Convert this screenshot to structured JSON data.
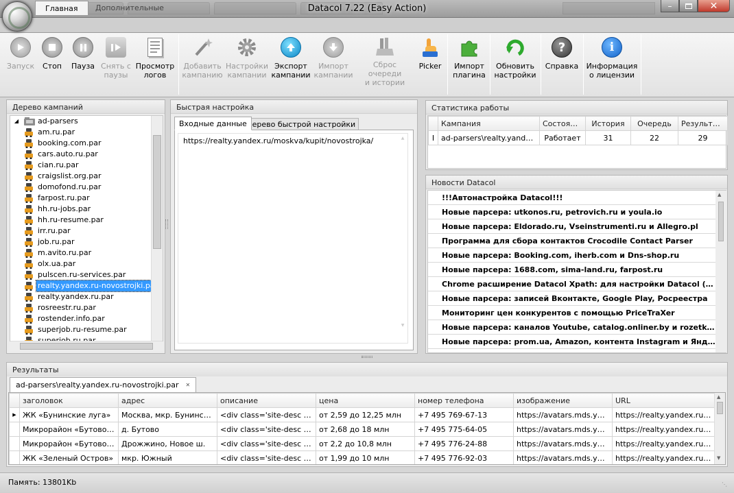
{
  "window": {
    "title": "Datacol 7.22 (Easy Action)"
  },
  "ribbon_tabs": [
    {
      "label": "Главная"
    },
    {
      "label": "Дополнительные"
    }
  ],
  "toolbar": {
    "start": {
      "l1": "Запуск",
      "l2": ""
    },
    "stop": {
      "l1": "Стоп",
      "l2": ""
    },
    "pause": {
      "l1": "Пауза",
      "l2": ""
    },
    "unpause": {
      "l1": "Снять с",
      "l2": "паузы"
    },
    "logs": {
      "l1": "Просмотр",
      "l2": "логов"
    },
    "add_campaign": {
      "l1": "Добавить",
      "l2": "кампанию"
    },
    "campaign_settings": {
      "l1": "Настройки",
      "l2": "кампании"
    },
    "export_campaign": {
      "l1": "Экспорт",
      "l2": "кампании"
    },
    "import_campaign": {
      "l1": "Импорт",
      "l2": "кампании"
    },
    "reset_queue": {
      "l1": "Сброс очереди",
      "l2": "и истории"
    },
    "picker": {
      "l1": "Picker",
      "l2": ""
    },
    "import_plugin": {
      "l1": "Импорт",
      "l2": "плагина"
    },
    "update_settings": {
      "l1": "Обновить",
      "l2": "настройки"
    },
    "help": {
      "l1": "Справка",
      "l2": ""
    },
    "license": {
      "l1": "Информация",
      "l2": "о лицензии"
    }
  },
  "campaign_tree": {
    "title": "Дерево кампаний",
    "root": "ad-parsers",
    "items": [
      "am.ru.par",
      "booking.com.par",
      "cars.auto.ru.par",
      "cian.ru.par",
      "craigslist.org.par",
      "domofond.ru.par",
      "farpost.ru.par",
      "hh.ru-jobs.par",
      "hh.ru-resume.par",
      "irr.ru.par",
      "job.ru.par",
      "m.avito.ru.par",
      "olx.ua.par",
      "pulscen.ru-services.par",
      "realty.yandex.ru-novostrojki.par",
      "realty.yandex.ru.par",
      "rosreestr.ru.par",
      "rostender.info.par",
      "superjob.ru-resume.par",
      "superjob.ru.par"
    ],
    "selected_index": 14
  },
  "quick_setup": {
    "title": "Быстрая настройка",
    "tabs": [
      "Входные данные",
      "Дерево быстрой настройки"
    ],
    "input_text": "https://realty.yandex.ru/moskva/kupit/novostrojka/"
  },
  "stats": {
    "title": "Статистика работы",
    "columns": [
      "Кампания",
      "Состояние",
      "История",
      "Очередь",
      "Результаты"
    ],
    "rows": [
      {
        "campaign": "ad-parsers\\realty.yandex.ru-novostrojki.par",
        "state": "Работает",
        "history": "31",
        "queue": "22",
        "results": "29"
      }
    ]
  },
  "news": {
    "title": "Новости Datacol",
    "items": [
      "!!!Автонастройка Datacol!!!",
      "Новые парсера: utkonos.ru, petrovich.ru и youla.io",
      "Новые парсера: Eldorado.ru, Vseinstrumenti.ru и Allegro.pl",
      "Программа для  сбора контактов Crocodile Contact Parser",
      "Новые парсера: Booking.com, iherb.com и Dns-shop.ru",
      "Новые парсера: 1688.com, sima-land.ru, farpost.ru",
      "Chrome расширение Datacol Xpath: для настройки Datacol (ВИДЕО)",
      "Новые парсера: записей Вконтакте, Google Play, Росреестра",
      "Мониторинг цен конкурентов с помощью PriceTraXer",
      "Новые парсера: каналов Youtube, catalog.onliner.by и rozetka.ua",
      "Новые парсера: prom.ua, Amazon, контента Instagram и Яндекс Маркет"
    ]
  },
  "results": {
    "title": "Результаты",
    "tab_label": "ad-parsers\\realty.yandex.ru-novostrojki.par",
    "columns": [
      "заголовок",
      "адрес",
      "описание",
      "цена",
      "номер телефона",
      "изображение",
      "URL"
    ],
    "rows": [
      [
        "ЖК «Бунинские луга»",
        "Москва, мкр. Бунинский, ...",
        "<div class='site-desc i-bem'...",
        "от 2,59 до 12,25 млн",
        "+7 495 769-67-13",
        "https://avatars.mds.yandex.net/...",
        "https://realty.yandex.ru/moskva/..."
      ],
      [
        "Микрорайон «Бутово Парк»",
        "д. Бутово",
        "<div class='site-desc i-bem'...",
        "от 2,68 до 18 млн",
        "+7 495 775-64-05",
        "https://avatars.mds.yandex.net/...",
        "https://realty.yandex.ru/moskva/..."
      ],
      [
        "Микрорайон «Бутово Парк 2»",
        "Дрожжино, Новое ш.",
        "<div class='site-desc i-bem'...",
        "от 2,2 до 10,8 млн",
        "+7 495 776-24-88",
        "https://avatars.mds.yandex.net/...",
        "https://realty.yandex.ru/moskva/..."
      ],
      [
        "ЖК «Зеленый Остров»",
        "мкр. Южный",
        "<div class='site-desc i-bem'...",
        "от 1,99 до 10 млн",
        "+7 495 776-92-03",
        "https://avatars.mds.yandex.net/...",
        "https://realty.yandex.ru/moskva/..."
      ]
    ],
    "current_row_index": 0
  },
  "status_bar": {
    "memory": "Память: 13801Kb"
  },
  "colors": {
    "selection": "#3399ff",
    "accent_blue": "#1e7fd8",
    "green": "#2eaa2e"
  }
}
